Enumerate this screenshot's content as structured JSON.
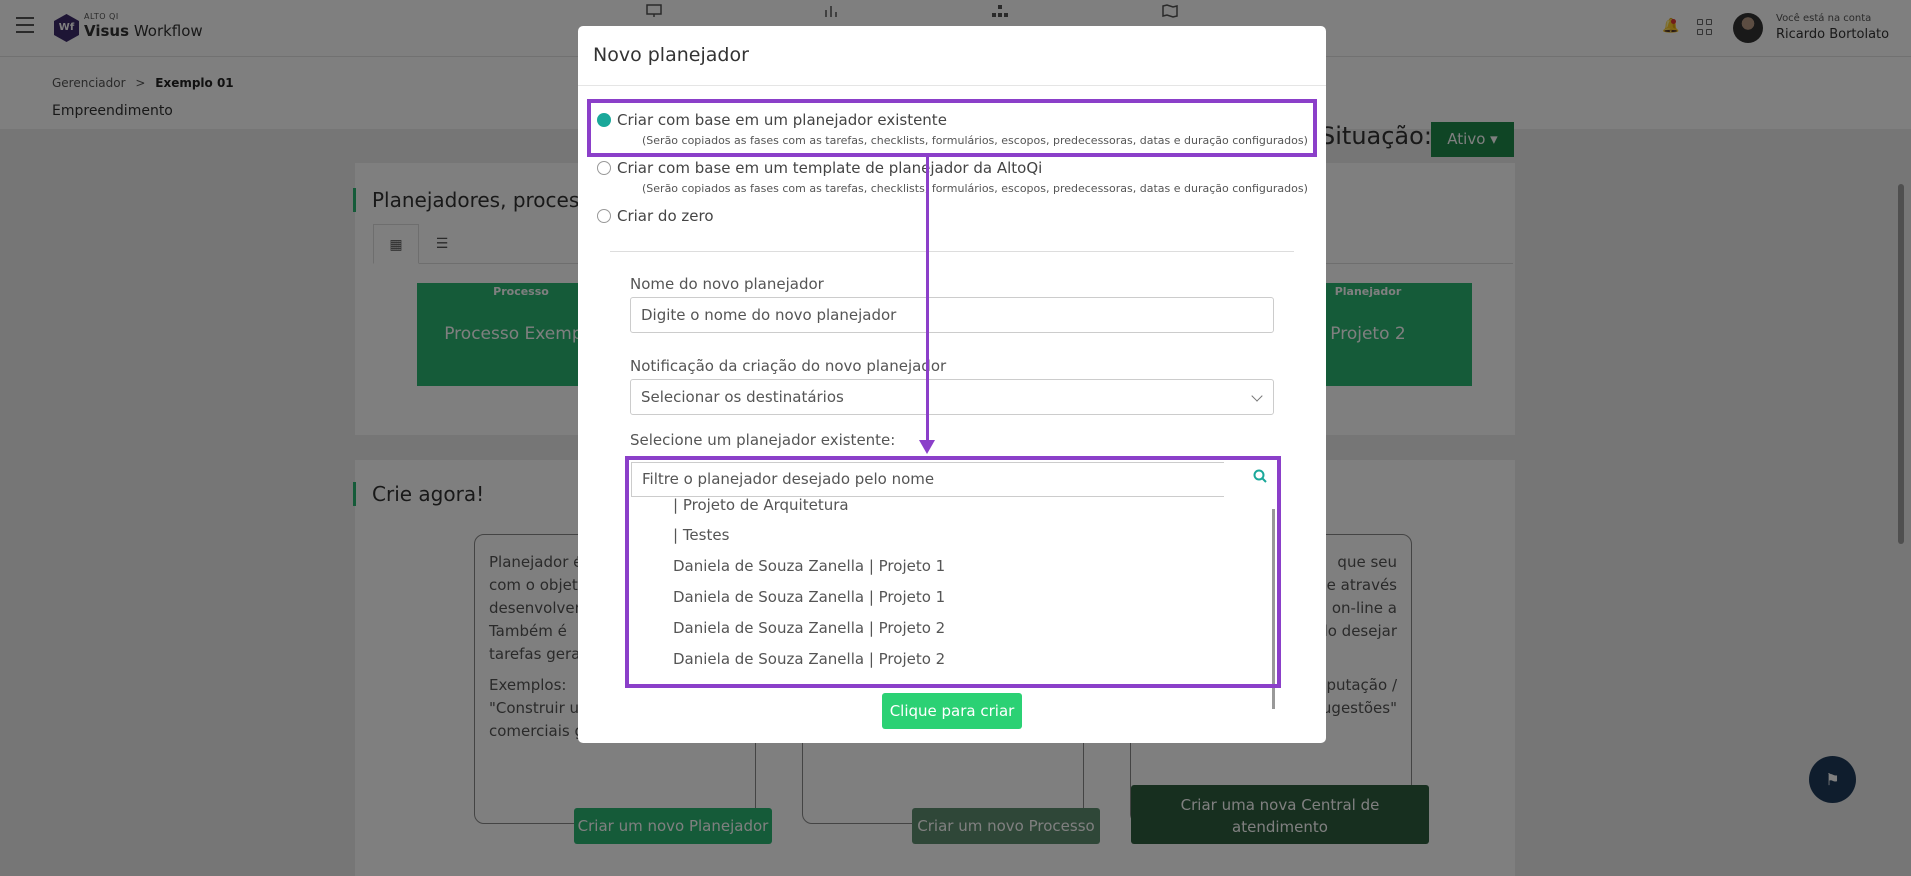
{
  "topbar": {
    "logo_small": "ALTO QI",
    "logo_brand": "Visus",
    "logo_product": "Workflow",
    "logo_badge": "Wf",
    "account_label": "Você está na conta",
    "account_name": "Ricardo Bortolato"
  },
  "breadcrumb": {
    "root": "Gerenciador",
    "separator": ">",
    "current": "Exemplo 01"
  },
  "page": {
    "subtitle": "Empreendimento",
    "situacao_label": "Situação:",
    "status": "Ativo",
    "section1_title": "Planejadores, processo",
    "section2_title": "Crie agora!",
    "cards": [
      {
        "tag": "Processo",
        "title": "Processo Exemplo"
      },
      {
        "tag": "Planejador",
        "title": "Projeto 2"
      }
    ],
    "crie_cards": [
      {
        "text": "Planejador é\ncom o objeti\ndesenvolver\nTambém é\ntarefas gerais",
        "examples_label": "Exemplos:",
        "examples": "\"Construir u\ncomerciais g",
        "button": "Criar um novo Planejador"
      },
      {
        "button": "Criar um novo Processo"
      },
      {
        "text": "que seu\nhe através\non-line a\ndo desejar",
        "examples": "putação /\nugestões\"",
        "button": "Criar uma nova Central de atendimento"
      }
    ]
  },
  "modal": {
    "title": "Novo planejador",
    "options": [
      {
        "label": "Criar com base em um planejador existente",
        "note": "(Serão copiados as fases com as tarefas, checklists, formulários, escopos, predecessoras, datas e duração configurados)",
        "checked": true
      },
      {
        "label": "Criar com base em um template de planejador da AltoQi",
        "note": "(Serão copiados as fases com as tarefas, checklists, formulários, escopos, predecessoras, datas e duração configurados)",
        "checked": false
      },
      {
        "label": "Criar do zero",
        "note": "",
        "checked": false
      }
    ],
    "name_label": "Nome do novo planejador",
    "name_placeholder": "Digite o nome do novo planejador",
    "notification_label": "Notificação da criação do novo planejador",
    "notification_placeholder": "Selecionar os destinatários",
    "select_label": "Selecione um planejador existente:",
    "filter_placeholder": "Filtre o planejador desejado pelo nome",
    "planners": [
      "| Projeto de Arquitetura",
      "| Testes",
      "Daniela de Souza Zanella | Projeto 1",
      "Daniela de Souza Zanella | Projeto 1",
      "Daniela de Souza Zanella | Projeto 2",
      "Daniela de Souza Zanella | Projeto 2"
    ],
    "create_button": "Clique para criar"
  },
  "colors": {
    "accent_green": "#2bb673",
    "radio_teal": "#1aa89a",
    "highlight_purple": "#8b3fc9"
  }
}
